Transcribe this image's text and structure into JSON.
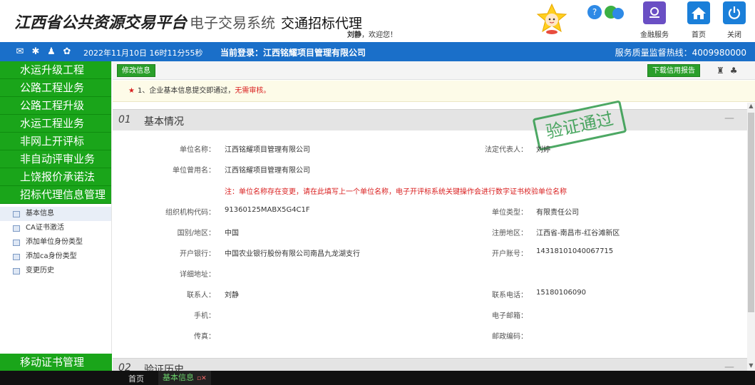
{
  "header": {
    "brand_main": "江西省公共资源交易平台",
    "brand_sub": "电子交易系统",
    "brand_sub2": "交通招标代理",
    "welcome_user": "刘静",
    "welcome_text": "，欢迎您！",
    "buttons": {
      "finance": "金融服务",
      "home": "首页",
      "close": "关闭"
    }
  },
  "bluebar": {
    "datetime": "2022年11月10日 16时11分55秒",
    "login_label": "当前登录：江西铭耀项目管理有限公司",
    "hotline": "服务质量监督热线：4009980000"
  },
  "sidebar": {
    "items": [
      {
        "label": "水运升级工程"
      },
      {
        "label": "公路工程业务"
      },
      {
        "label": "公路工程升级"
      },
      {
        "label": "水运工程业务"
      },
      {
        "label": "非网上开评标"
      },
      {
        "label": "非自动评审业务"
      },
      {
        "label": "上饶报价承诺法"
      },
      {
        "label": "招标代理信息管理"
      }
    ],
    "sub_items": [
      {
        "label": "基本信息"
      },
      {
        "label": "CA证书激活"
      },
      {
        "label": "添加单位身份类型"
      },
      {
        "label": "添加ca身份类型"
      },
      {
        "label": "变更历史"
      }
    ],
    "bottom_item": "移动证书管理"
  },
  "toolbar": {
    "edit_label": "修改信息",
    "download_label": "下载信用报告"
  },
  "notice": {
    "text": "1、企业基本信息提交即通过，",
    "highlight": "无需审核。"
  },
  "section1": {
    "num": "01",
    "title": "基本情况",
    "stamp": "验证通过",
    "fields": {
      "unit_name_label": "单位名称：",
      "unit_name": "江西铭耀项目管理有限公司",
      "legal_rep_label": "法定代表人：",
      "legal_rep": "刘婷",
      "former_name_label": "单位曾用名：",
      "former_name": "江西铭耀项目管理有限公司",
      "note": "注：单位名称存在变更，请在此填写上一个单位名称，电子开评标系统关键操作会进行数字证书校验单位名称",
      "org_code_label": "组织机构代码：",
      "org_code": "91360125MABX5G4C1F",
      "unit_type_label": "单位类型：",
      "unit_type": "有限责任公司",
      "country_label": "国别/地区：",
      "country": "中国",
      "reg_area_label": "注册地区：",
      "reg_area": "江西省-南昌市-红谷滩新区",
      "bank_label": "开户银行：",
      "bank": "中国农业银行股份有限公司南昌九龙湖支行",
      "account_label": "开户账号：",
      "account": "14318101040067715",
      "address_label": "详细地址：",
      "contact_label": "联系人：",
      "contact": "刘静",
      "phone_label": "联系电话：",
      "phone": "15180106090",
      "mobile_label": "手机：",
      "email_label": "电子邮箱：",
      "fax_label": "传真：",
      "postcode_label": "邮政编码："
    }
  },
  "section2": {
    "num": "02",
    "title": "验证历史"
  },
  "bottombar": {
    "home_tab": "首页",
    "active_tab": "基本信息"
  }
}
